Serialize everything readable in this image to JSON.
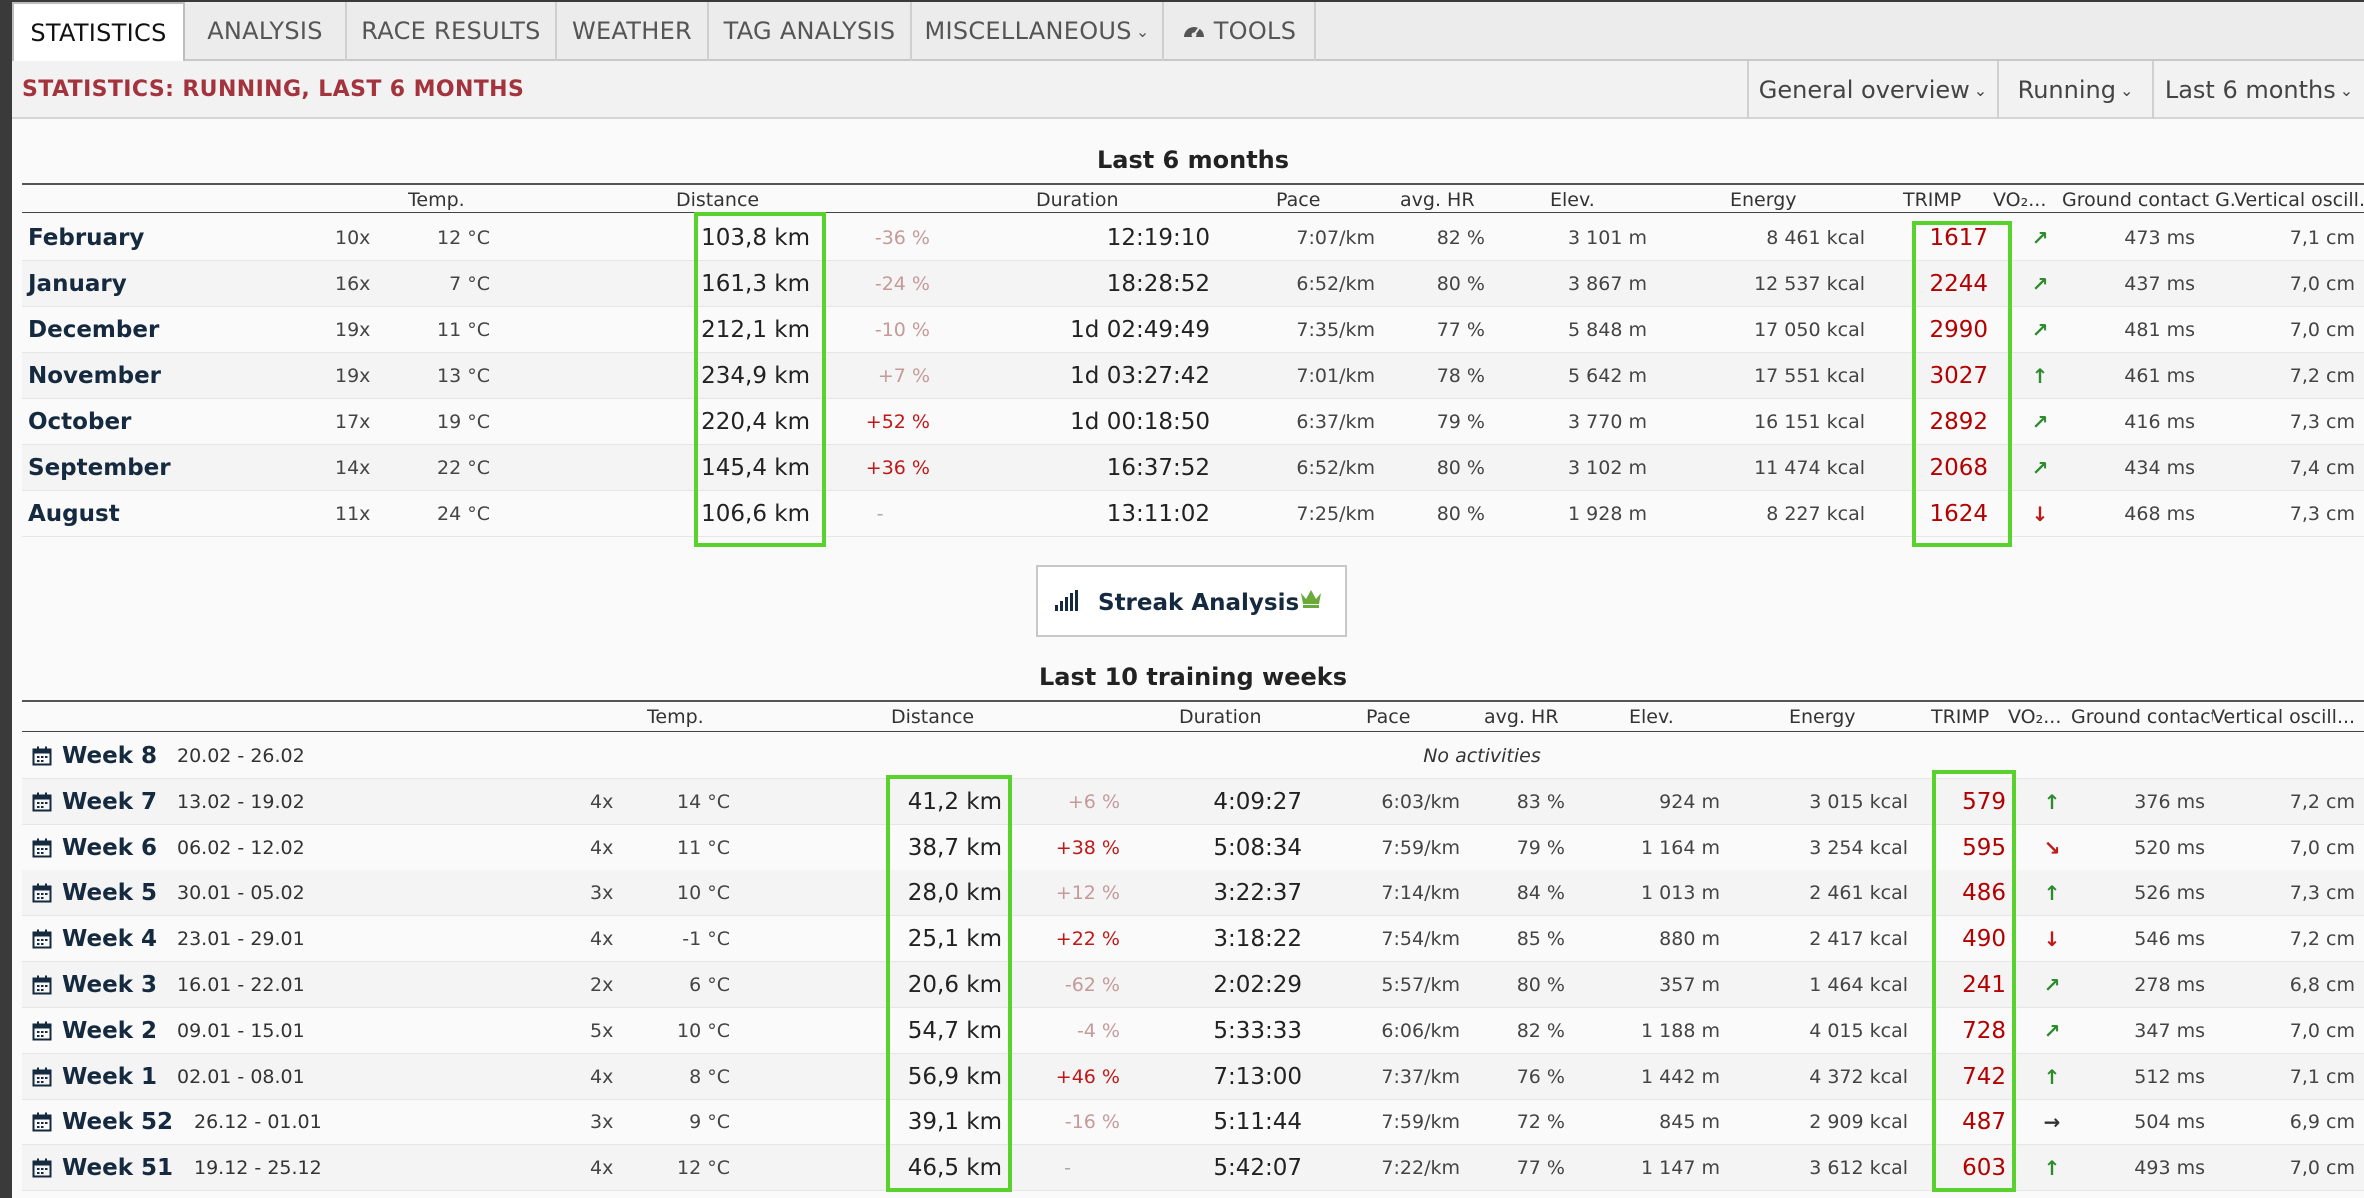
{
  "tabs": [
    {
      "label": "STATISTICS",
      "active": true
    },
    {
      "label": "ANALYSIS"
    },
    {
      "label": "RACE RESULTS"
    },
    {
      "label": "WEATHER"
    },
    {
      "label": "TAG ANALYSIS"
    },
    {
      "label": "MISCELLANEOUS",
      "dropdown": true
    },
    {
      "label": "TOOLS",
      "icon": "speedometer-icon"
    }
  ],
  "section": {
    "title": "STATISTICS: RUNNING, LAST 6 MONTHS",
    "dropdowns": [
      "General overview",
      "Running",
      "Last 6 months"
    ]
  },
  "months_table": {
    "caption": "Last 6 months",
    "headers": [
      "Temp.",
      "Distance",
      "Duration",
      "Pace",
      "avg. HR",
      "Elev.",
      "Energy",
      "TRIMP",
      "VO₂...",
      "Ground contact G...",
      "Vertical oscill..."
    ],
    "rows": [
      {
        "name": "February",
        "count": "10x",
        "temp": "12 °C",
        "distance": "103,8 km",
        "change": "-36 %",
        "change_kind": "neg",
        "duration": "12:19:10",
        "pace": "7:07/km",
        "hr": "82 %",
        "elev": "3 101 m",
        "energy": "8 461 kcal",
        "trimp": "1617",
        "vo2": "up-right",
        "gct": "473 ms",
        "vo": "7,1 cm"
      },
      {
        "name": "January",
        "count": "16x",
        "temp": "7 °C",
        "distance": "161,3 km",
        "change": "-24 %",
        "change_kind": "neg",
        "duration": "18:28:52",
        "pace": "6:52/km",
        "hr": "80 %",
        "elev": "3 867 m",
        "energy": "12 537 kcal",
        "trimp": "2244",
        "vo2": "up-right",
        "gct": "437 ms",
        "vo": "7,0 cm"
      },
      {
        "name": "December",
        "count": "19x",
        "temp": "11 °C",
        "distance": "212,1 km",
        "change": "-10 %",
        "change_kind": "neg",
        "duration": "1d 02:49:49",
        "pace": "7:35/km",
        "hr": "77 %",
        "elev": "5 848 m",
        "energy": "17 050 kcal",
        "trimp": "2990",
        "vo2": "up-right",
        "gct": "481 ms",
        "vo": "7,0 cm"
      },
      {
        "name": "November",
        "count": "19x",
        "temp": "13 °C",
        "distance": "234,9 km",
        "change": "+7 %",
        "change_kind": "posl",
        "duration": "1d 03:27:42",
        "pace": "7:01/km",
        "hr": "78 %",
        "elev": "5 642 m",
        "energy": "17 551 kcal",
        "trimp": "3027",
        "vo2": "up",
        "gct": "461 ms",
        "vo": "7,2 cm"
      },
      {
        "name": "October",
        "count": "17x",
        "temp": "19 °C",
        "distance": "220,4 km",
        "change": "+52 %",
        "change_kind": "pos",
        "duration": "1d 00:18:50",
        "pace": "6:37/km",
        "hr": "79 %",
        "elev": "3 770 m",
        "energy": "16 151 kcal",
        "trimp": "2892",
        "vo2": "up-right",
        "gct": "416 ms",
        "vo": "7,3 cm"
      },
      {
        "name": "September",
        "count": "14x",
        "temp": "22 °C",
        "distance": "145,4 km",
        "change": "+36 %",
        "change_kind": "pos",
        "duration": "16:37:52",
        "pace": "6:52/km",
        "hr": "80 %",
        "elev": "3 102 m",
        "energy": "11 474 kcal",
        "trimp": "2068",
        "vo2": "up-right",
        "gct": "434 ms",
        "vo": "7,4 cm"
      },
      {
        "name": "August",
        "count": "11x",
        "temp": "24 °C",
        "distance": "106,6 km",
        "change": "-",
        "change_kind": "none",
        "duration": "13:11:02",
        "pace": "7:25/km",
        "hr": "80 %",
        "elev": "1 928 m",
        "energy": "8 227 kcal",
        "trimp": "1624",
        "vo2": "down",
        "gct": "468 ms",
        "vo": "7,3 cm"
      }
    ]
  },
  "streak_button": {
    "label": "Streak Analysis",
    "icon": "signal-bars-icon",
    "badge": "crown-icon"
  },
  "weeks_table": {
    "caption": "Last 10 training weeks",
    "headers": [
      "Temp.",
      "Distance",
      "Duration",
      "Pace",
      "avg. HR",
      "Elev.",
      "Energy",
      "TRIMP",
      "VO₂...",
      "Ground contact G...",
      "Vertical oscill..."
    ],
    "no_activities": "No activities",
    "rows": [
      {
        "name": "Week 8",
        "dates": "20.02 - 26.02",
        "empty": true
      },
      {
        "name": "Week 7",
        "dates": "13.02 - 19.02",
        "count": "4x",
        "temp": "14 °C",
        "distance": "41,2 km",
        "change": "+6 %",
        "change_kind": "posl",
        "duration": "4:09:27",
        "pace": "6:03/km",
        "hr": "83 %",
        "elev": "924 m",
        "energy": "3 015 kcal",
        "trimp": "579",
        "vo2": "up",
        "gct": "376 ms",
        "vo": "7,2 cm"
      },
      {
        "name": "Week 6",
        "dates": "06.02 - 12.02",
        "count": "4x",
        "temp": "11 °C",
        "distance": "38,7 km",
        "change": "+38 %",
        "change_kind": "pos",
        "duration": "5:08:34",
        "pace": "7:59/km",
        "hr": "79 %",
        "elev": "1 164 m",
        "energy": "3 254 kcal",
        "trimp": "595",
        "vo2": "down-right",
        "gct": "520 ms",
        "vo": "7,0 cm"
      },
      {
        "name": "Week 5",
        "dates": "30.01 - 05.02",
        "count": "3x",
        "temp": "10 °C",
        "distance": "28,0 km",
        "change": "+12 %",
        "change_kind": "posl",
        "duration": "3:22:37",
        "pace": "7:14/km",
        "hr": "84 %",
        "elev": "1 013 m",
        "energy": "2 461 kcal",
        "trimp": "486",
        "vo2": "up",
        "gct": "526 ms",
        "vo": "7,3 cm"
      },
      {
        "name": "Week 4",
        "dates": "23.01 - 29.01",
        "count": "4x",
        "temp": "-1 °C",
        "distance": "25,1 km",
        "change": "+22 %",
        "change_kind": "pos",
        "duration": "3:18:22",
        "pace": "7:54/km",
        "hr": "85 %",
        "elev": "880 m",
        "energy": "2 417 kcal",
        "trimp": "490",
        "vo2": "down",
        "gct": "546 ms",
        "vo": "7,2 cm"
      },
      {
        "name": "Week 3",
        "dates": "16.01 - 22.01",
        "count": "2x",
        "temp": "6 °C",
        "distance": "20,6 km",
        "change": "-62 %",
        "change_kind": "neg",
        "duration": "2:02:29",
        "pace": "5:57/km",
        "hr": "80 %",
        "elev": "357 m",
        "energy": "1 464 kcal",
        "trimp": "241",
        "vo2": "up-right",
        "gct": "278 ms",
        "vo": "6,8 cm"
      },
      {
        "name": "Week 2",
        "dates": "09.01 - 15.01",
        "count": "5x",
        "temp": "10 °C",
        "distance": "54,7 km",
        "change": "-4 %",
        "change_kind": "neg",
        "duration": "5:33:33",
        "pace": "6:06/km",
        "hr": "82 %",
        "elev": "1 188 m",
        "energy": "4 015 kcal",
        "trimp": "728",
        "vo2": "up-right",
        "gct": "347 ms",
        "vo": "7,0 cm"
      },
      {
        "name": "Week 1",
        "dates": "02.01 - 08.01",
        "count": "4x",
        "temp": "8 °C",
        "distance": "56,9 km",
        "change": "+46 %",
        "change_kind": "pos",
        "duration": "7:13:00",
        "pace": "7:37/km",
        "hr": "76 %",
        "elev": "1 442 m",
        "energy": "4 372 kcal",
        "trimp": "742",
        "vo2": "up",
        "gct": "512 ms",
        "vo": "7,1 cm"
      },
      {
        "name": "Week 52",
        "dates": "26.12 - 01.01",
        "count": "3x",
        "temp": "9 °C",
        "distance": "39,1 km",
        "change": "-16 %",
        "change_kind": "neg",
        "duration": "5:11:44",
        "pace": "7:59/km",
        "hr": "72 %",
        "elev": "845 m",
        "energy": "2 909 kcal",
        "trimp": "487",
        "vo2": "right",
        "gct": "504 ms",
        "vo": "6,9 cm"
      },
      {
        "name": "Week 51",
        "dates": "19.12 - 25.12",
        "count": "4x",
        "temp": "12 °C",
        "distance": "46,5 km",
        "change": "-",
        "change_kind": "none",
        "duration": "5:42:07",
        "pace": "7:22/km",
        "hr": "77 %",
        "elev": "1 147 m",
        "energy": "3 612 kcal",
        "trimp": "603",
        "vo2": "up",
        "gct": "493 ms",
        "vo": "7,0 cm"
      }
    ]
  },
  "colors": {
    "title_red": "#a3333d",
    "trimp_red": "#b30000",
    "highlight_green": "#5ad22e",
    "arrow_up": "#2e8b2e",
    "arrow_down": "#c01818"
  }
}
